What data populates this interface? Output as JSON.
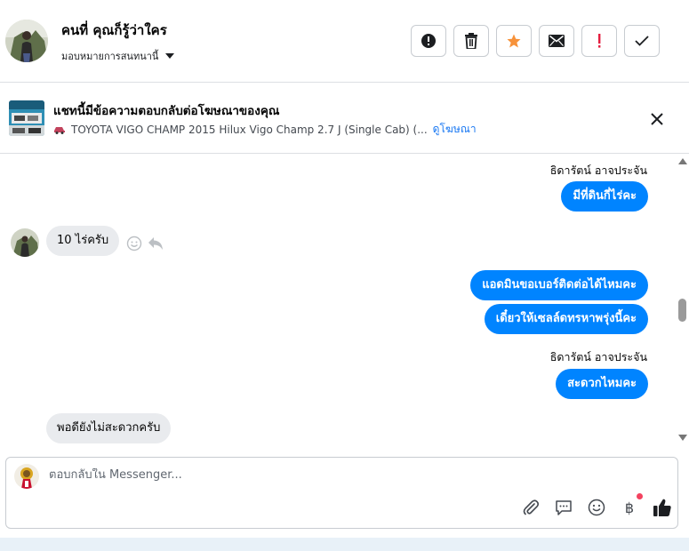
{
  "header": {
    "contact_name": "คนที่ คุณก็รู้ว่าใคร",
    "assign_label": "มอบหมายการสนทนานี้"
  },
  "actions": [
    {
      "name": "spam-icon"
    },
    {
      "name": "trash-icon"
    },
    {
      "name": "star-icon",
      "color": "#f7923a"
    },
    {
      "name": "mail-icon"
    },
    {
      "name": "important-icon",
      "color": "#e41e3f"
    },
    {
      "name": "check-icon"
    }
  ],
  "banner": {
    "title": "แชทนี้มีข้อความตอบกลับต่อโฆษณาของคุณ",
    "ad_text": "TOYOTA VIGO CHAMP 2015 Hilux Vigo Champ 2.7 J (Single Cab) (...",
    "link": "ดูโฆษณา"
  },
  "messages": [
    {
      "direction": "out",
      "sender": "ธิดารัตน์ อาจประจัน",
      "text": "มีที่ดินกี่ไร่คะ"
    },
    {
      "direction": "in",
      "text": "10 ไร่ครับ"
    },
    {
      "direction": "out",
      "text": "แอดมินขอเบอร์ติดต่อได้ไหมคะ"
    },
    {
      "direction": "out",
      "text": "เดี๋ยวให้เซลล์ดทรหาพรุ่งนี้คะ"
    },
    {
      "direction": "out",
      "sender": "ธิดารัตน์ อาจประจัน",
      "text": "สะดวกไหมคะ"
    },
    {
      "direction": "in",
      "text": "พอดียังไม่สะดวกครับ"
    }
  ],
  "composer": {
    "placeholder": "ตอบกลับใน Messenger...",
    "baht_symbol": "฿"
  },
  "colors": {
    "accent": "#0084ff",
    "link": "#1877f2",
    "incoming_bubble": "#e9ebee"
  }
}
